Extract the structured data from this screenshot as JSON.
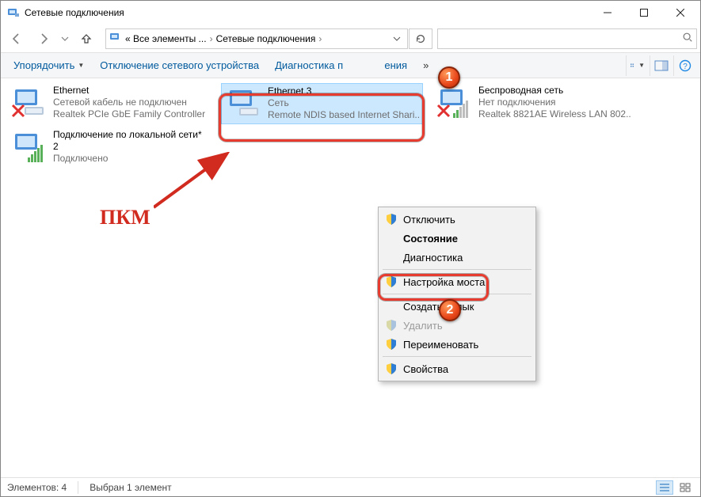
{
  "window": {
    "title": "Сетевые подключения"
  },
  "breadcrumbs": {
    "prefix": "« Все элементы ...",
    "current": "Сетевые подключения"
  },
  "cmdbar": {
    "organize": "Упорядочить",
    "disable": "Отключение сетевого устройства",
    "diag": "Диагностика п",
    "diag_tail": "ения",
    "more": "»"
  },
  "connections": [
    {
      "name": "Ethernet",
      "l2": "Сетевой кабель не подключен",
      "l3": "Realtek PCIe GbE Family Controller"
    },
    {
      "name": "Ethernet 3",
      "l2": "Сеть",
      "l3": "Remote NDIS based Internet Shari..."
    },
    {
      "name": "Беспроводная сеть",
      "l2": "Нет подключения",
      "l3": "Realtek 8821AE Wireless LAN 802...."
    },
    {
      "name": "Подключение по локальной сети* 2",
      "l2": "Подключено",
      "l3": ""
    }
  ],
  "pkm": "ПКМ",
  "bubbles": {
    "one": "1",
    "two": "2"
  },
  "ctx": {
    "disable": "Отключить",
    "status": "Состояние",
    "diag": "Диагностика",
    "bridge": "Настройка моста",
    "shortcut": "Создать ярлык",
    "delete": "Удалить",
    "rename": "Переименовать",
    "props": "Свойства"
  },
  "status": {
    "count": "Элементов: 4",
    "selected": "Выбран 1 элемент"
  }
}
